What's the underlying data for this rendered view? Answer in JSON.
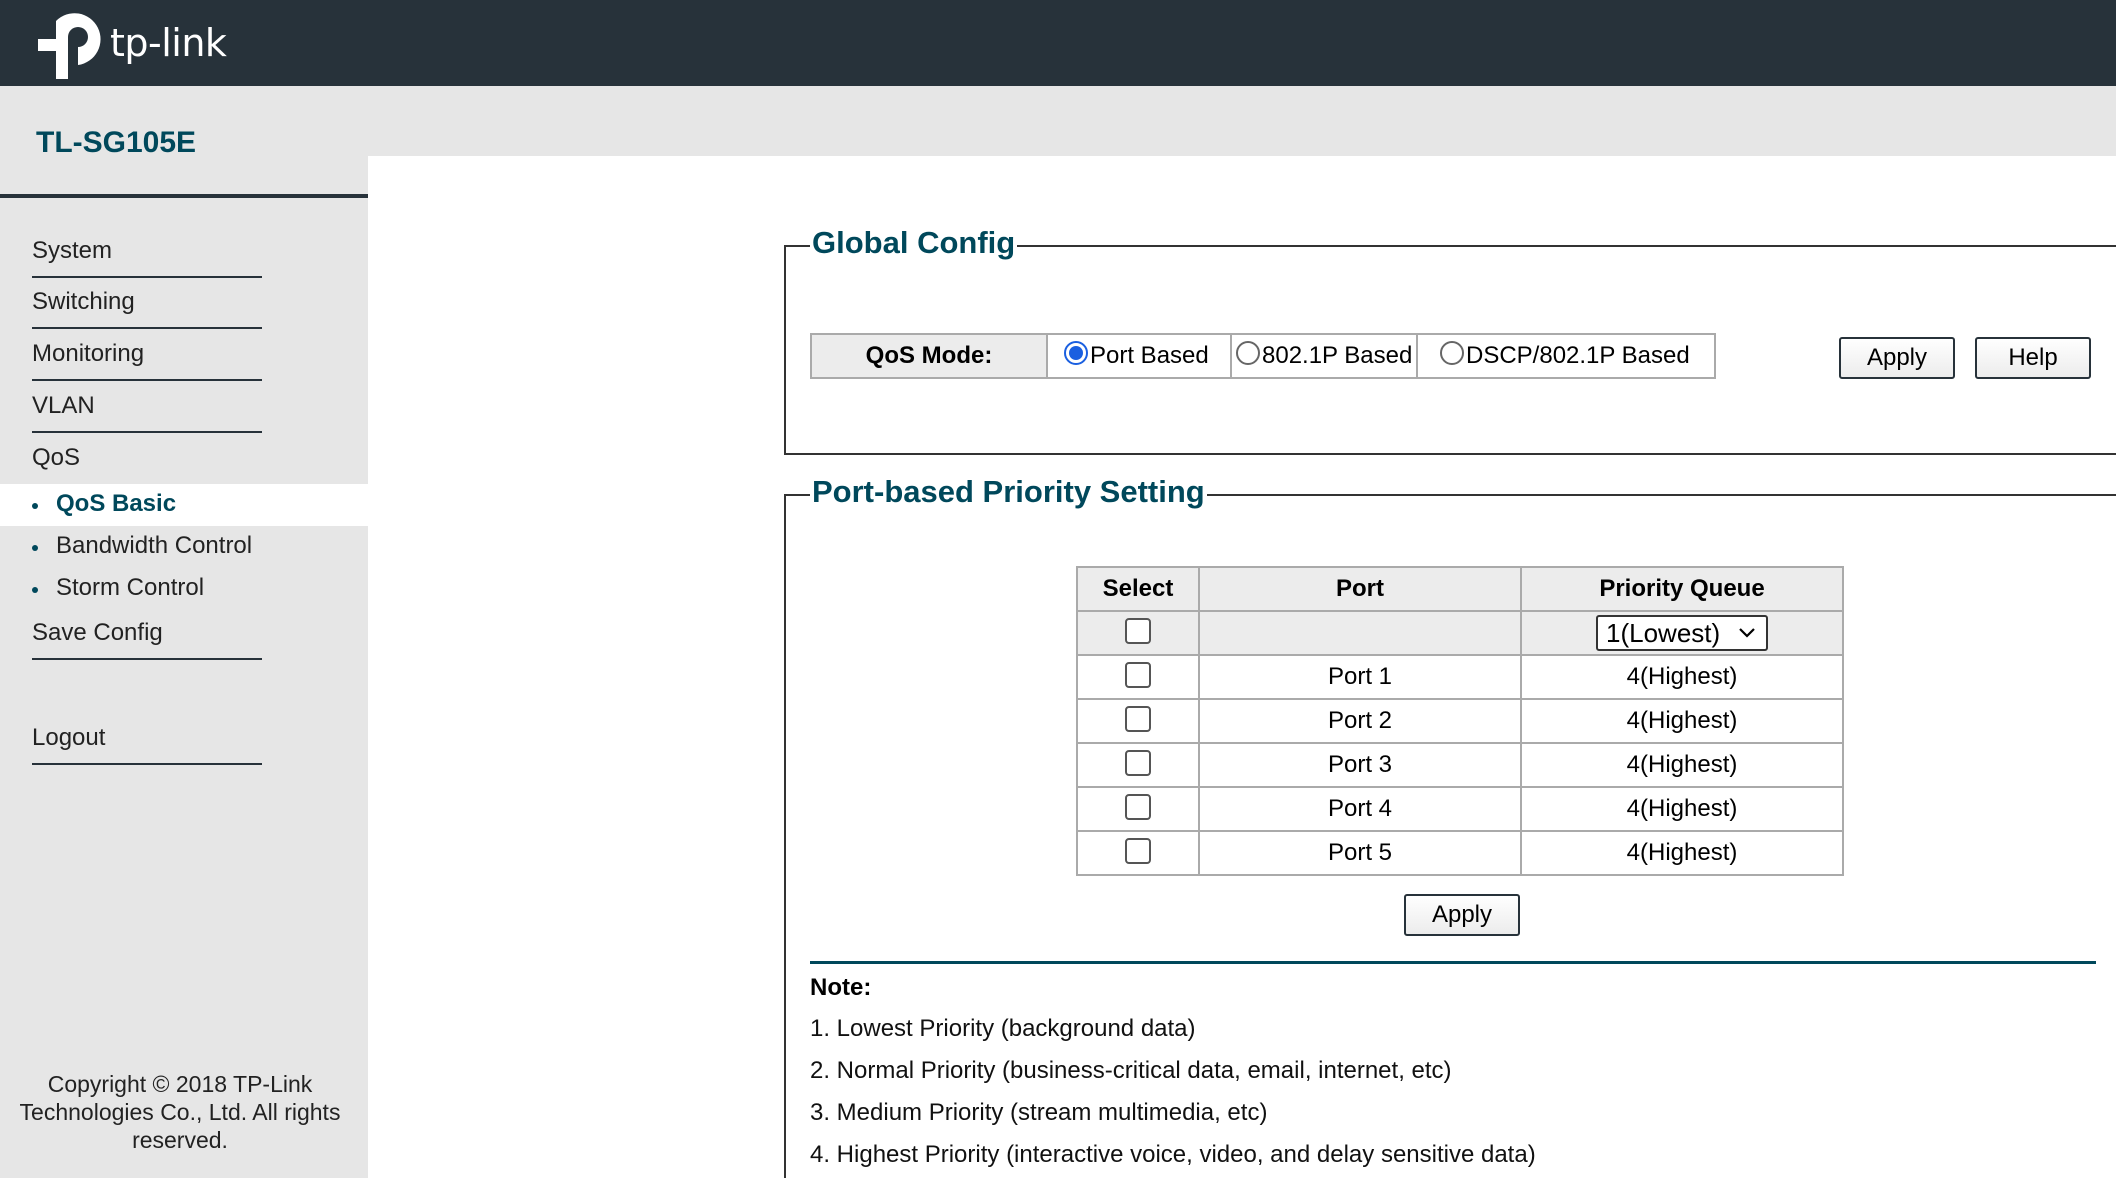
{
  "header": {
    "logo_text": "tp-link",
    "colors": {
      "bar": "#27323a",
      "accent": "#00485b"
    }
  },
  "sidebar": {
    "model": "TL-SG105E",
    "items": [
      {
        "label": "System"
      },
      {
        "label": "Switching"
      },
      {
        "label": "Monitoring"
      },
      {
        "label": "VLAN"
      },
      {
        "label": "QoS"
      }
    ],
    "sub_items": [
      {
        "label": "QoS Basic",
        "active": true
      },
      {
        "label": "Bandwidth Control",
        "active": false
      },
      {
        "label": "Storm Control",
        "active": false
      }
    ],
    "save_config": "Save Config",
    "logout": "Logout",
    "copyright": "Copyright © 2018 TP-Link Technologies Co., Ltd. All rights reserved."
  },
  "global_config": {
    "title": "Global Config",
    "qos_mode_label": "QoS Mode:",
    "options": [
      {
        "label": "Port Based",
        "selected": true
      },
      {
        "label": "802.1P Based",
        "selected": false
      },
      {
        "label": "DSCP/802.1P Based",
        "selected": false
      }
    ],
    "apply_label": "Apply",
    "help_label": "Help"
  },
  "port_priority": {
    "title": "Port-based Priority Setting",
    "columns": [
      "Select",
      "Port",
      "Priority Queue"
    ],
    "select_all_value": "1(Lowest)",
    "rows": [
      {
        "port": "Port 1",
        "queue": "4(Highest)"
      },
      {
        "port": "Port 2",
        "queue": "4(Highest)"
      },
      {
        "port": "Port 3",
        "queue": "4(Highest)"
      },
      {
        "port": "Port 4",
        "queue": "4(Highest)"
      },
      {
        "port": "Port 5",
        "queue": "4(Highest)"
      }
    ],
    "apply_label": "Apply"
  },
  "note": {
    "title": "Note:",
    "lines": [
      "1. Lowest Priority (background data)",
      "2. Normal Priority (business-critical data, email, internet, etc)",
      "3. Medium Priority (stream multimedia, etc)",
      "4. Highest Priority (interactive voice, video, and delay sensitive data)"
    ]
  }
}
